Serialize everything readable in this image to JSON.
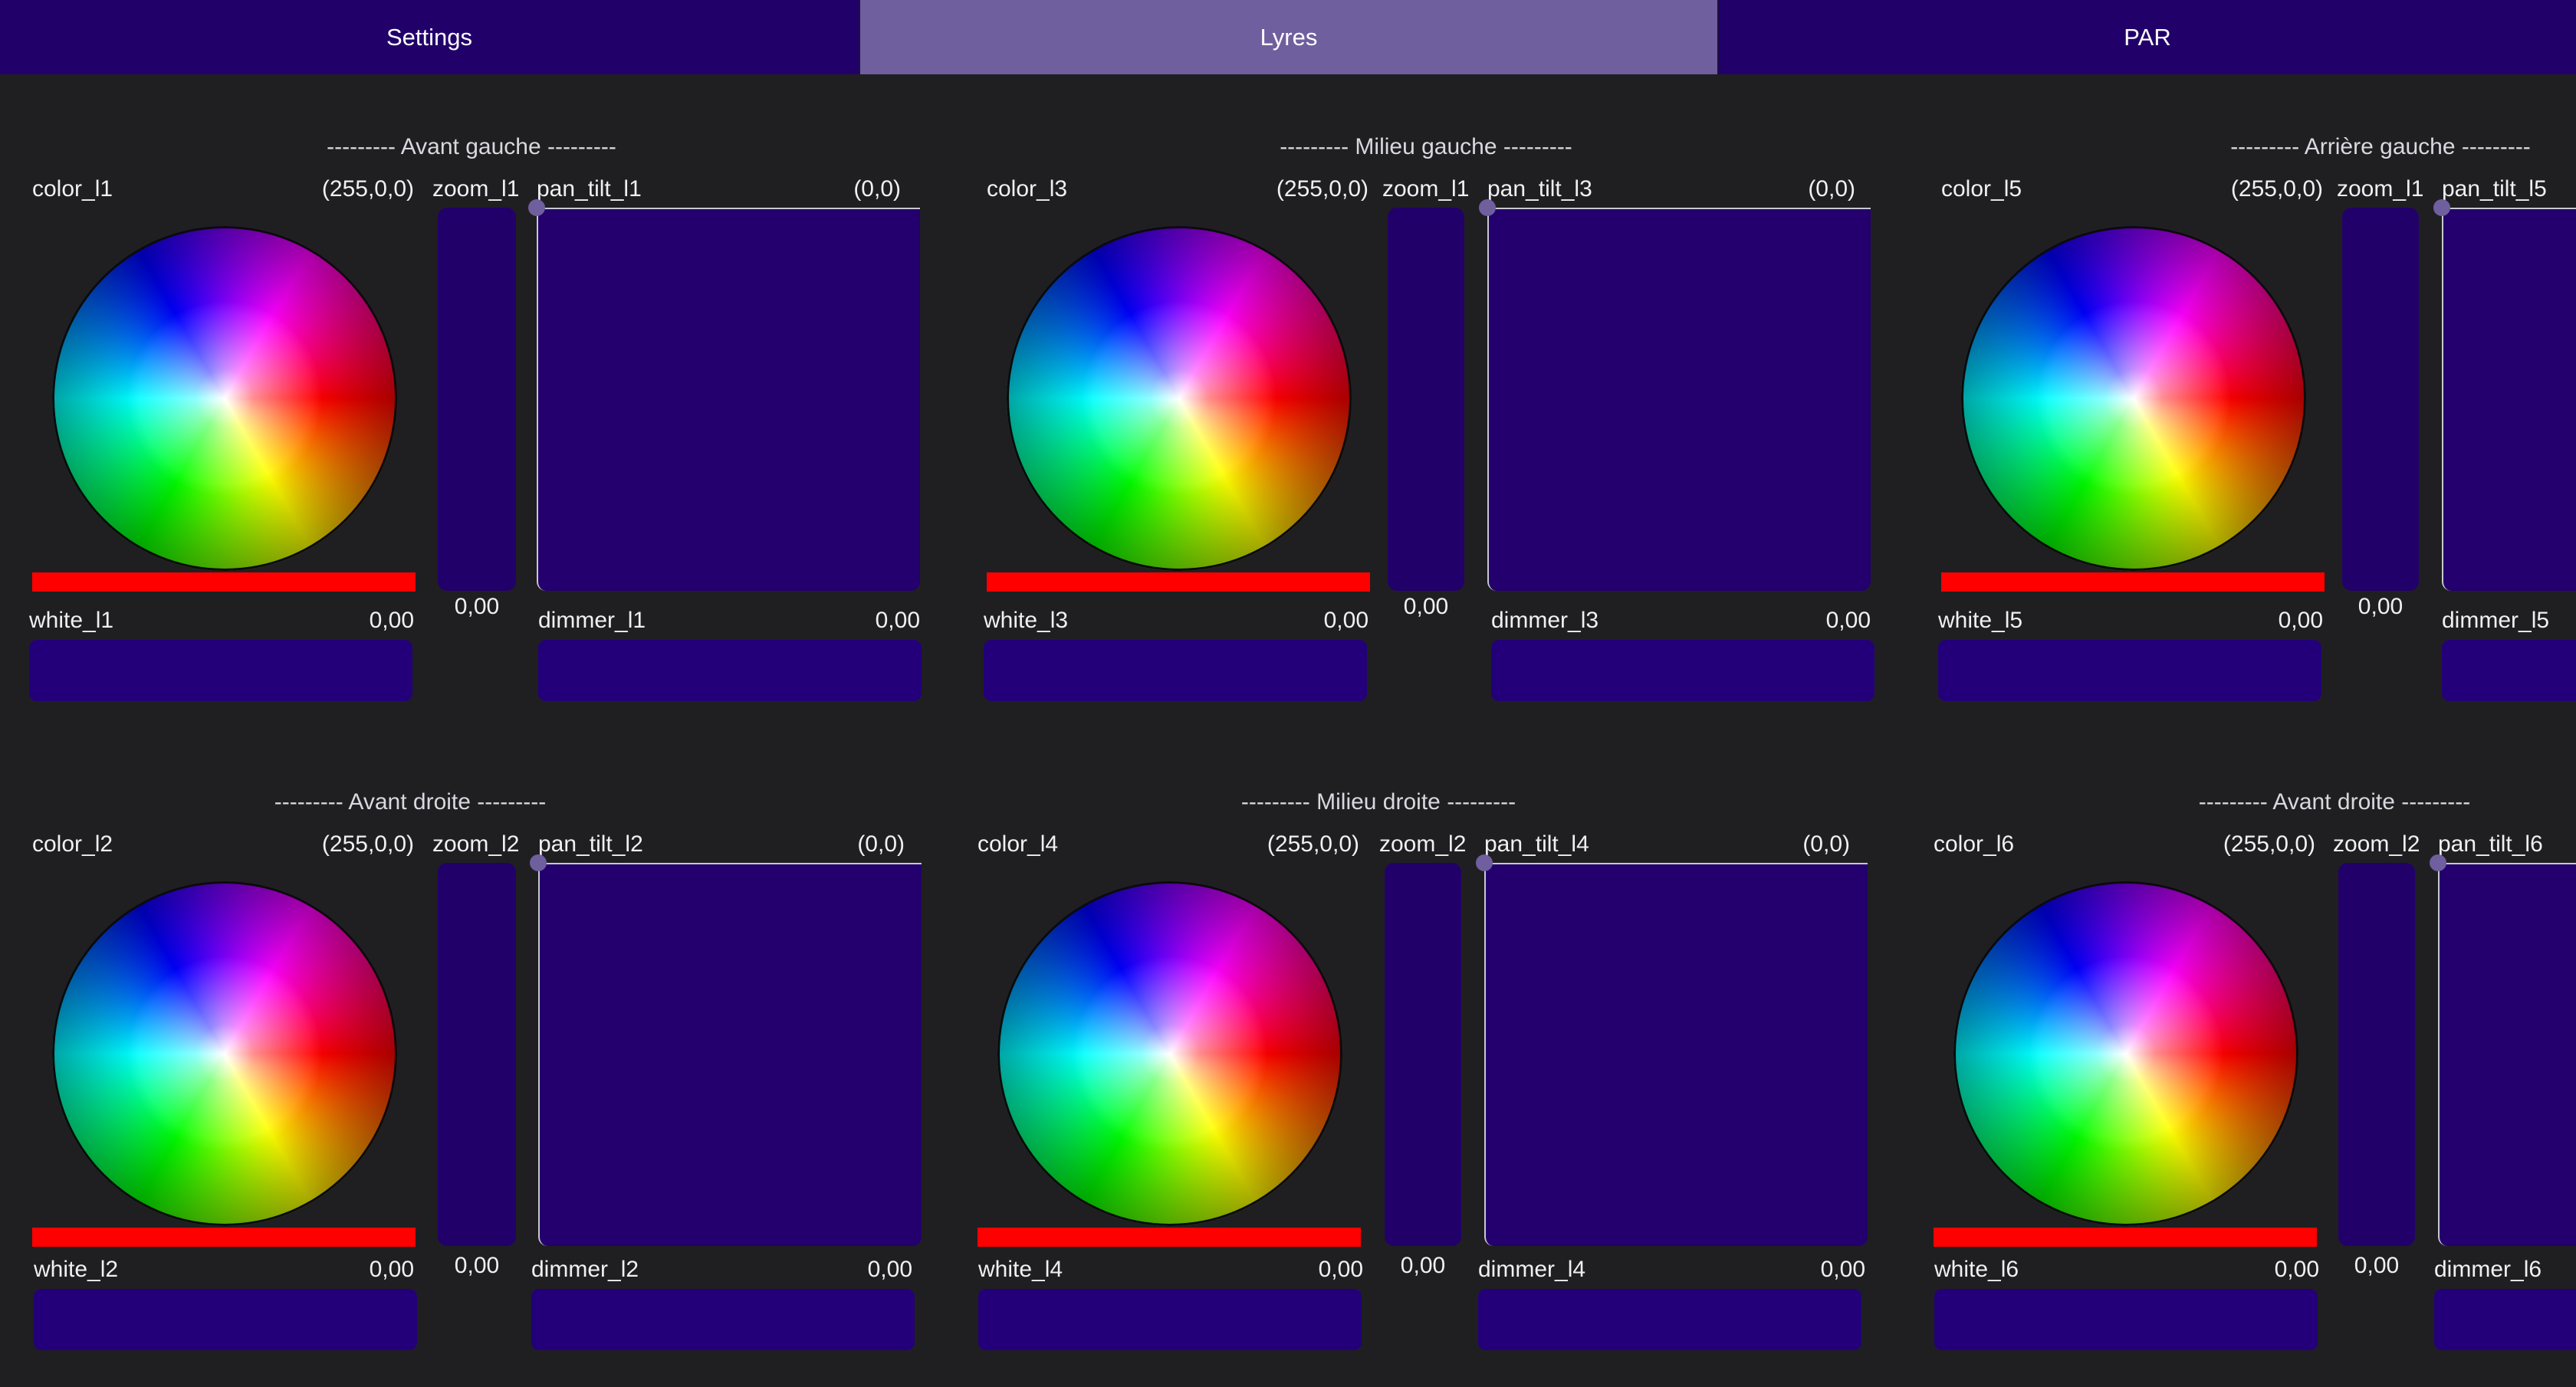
{
  "tabs": [
    {
      "label": "Settings",
      "active": false
    },
    {
      "label": "Lyres",
      "active": true
    },
    {
      "label": "PAR",
      "active": false
    }
  ],
  "groups": [
    {
      "title": "--------- Avant gauche ---------",
      "color_label": "color_l1",
      "color_value": "(255,0,0)",
      "zoom_label": "zoom_l1",
      "zoom_value": "0,00",
      "pan_label": "pan_tilt_l1",
      "pan_value": "(0,0)",
      "white_label": "white_l1",
      "white_value": "0,00",
      "dimmer_label": "dimmer_l1",
      "dimmer_value": "0,00"
    },
    {
      "title": "--------- Milieu gauche ---------",
      "color_label": "color_l3",
      "color_value": "(255,0,0)",
      "zoom_label": "zoom_l1",
      "zoom_value": "0,00",
      "pan_label": "pan_tilt_l3",
      "pan_value": "(0,0)",
      "white_label": "white_l3",
      "white_value": "0,00",
      "dimmer_label": "dimmer_l3",
      "dimmer_value": "0,00"
    },
    {
      "title": "--------- Arrière gauche ---------",
      "color_label": "color_l5",
      "color_value": "(255,0,0)",
      "zoom_label": "zoom_l1",
      "zoom_value": "0,00",
      "pan_label": "pan_tilt_l5",
      "pan_value": "",
      "white_label": "white_l5",
      "white_value": "0,00",
      "dimmer_label": "dimmer_l5",
      "dimmer_value": ""
    },
    {
      "title": "--------- Avant droite ---------",
      "color_label": "color_l2",
      "color_value": "(255,0,0)",
      "zoom_label": "zoom_l2",
      "zoom_value": "0,00",
      "pan_label": "pan_tilt_l2",
      "pan_value": "(0,0)",
      "white_label": "white_l2",
      "white_value": "0,00",
      "dimmer_label": "dimmer_l2",
      "dimmer_value": "0,00"
    },
    {
      "title": "--------- Milieu droite ---------",
      "color_label": "color_l4",
      "color_value": "(255,0,0)",
      "zoom_label": "zoom_l2",
      "zoom_value": "0,00",
      "pan_label": "pan_tilt_l4",
      "pan_value": "(0,0)",
      "white_label": "white_l4",
      "white_value": "0,00",
      "dimmer_label": "dimmer_l4",
      "dimmer_value": "0,00"
    },
    {
      "title": "--------- Avant droite ---------",
      "color_label": "color_l6",
      "color_value": "(255,0,0)",
      "zoom_label": "zoom_l2",
      "zoom_value": "0,00",
      "pan_label": "pan_tilt_l6",
      "pan_value": "",
      "white_label": "white_l6",
      "white_value": "0,00",
      "dimmer_label": "dimmer_l6",
      "dimmer_value": ""
    }
  ],
  "colors": {
    "tab_bar": "#22006a",
    "tab_active": "#6f5f9e",
    "control_fill": "#23006e",
    "color_bar": "#ff0000",
    "background": "#1f1f21"
  }
}
